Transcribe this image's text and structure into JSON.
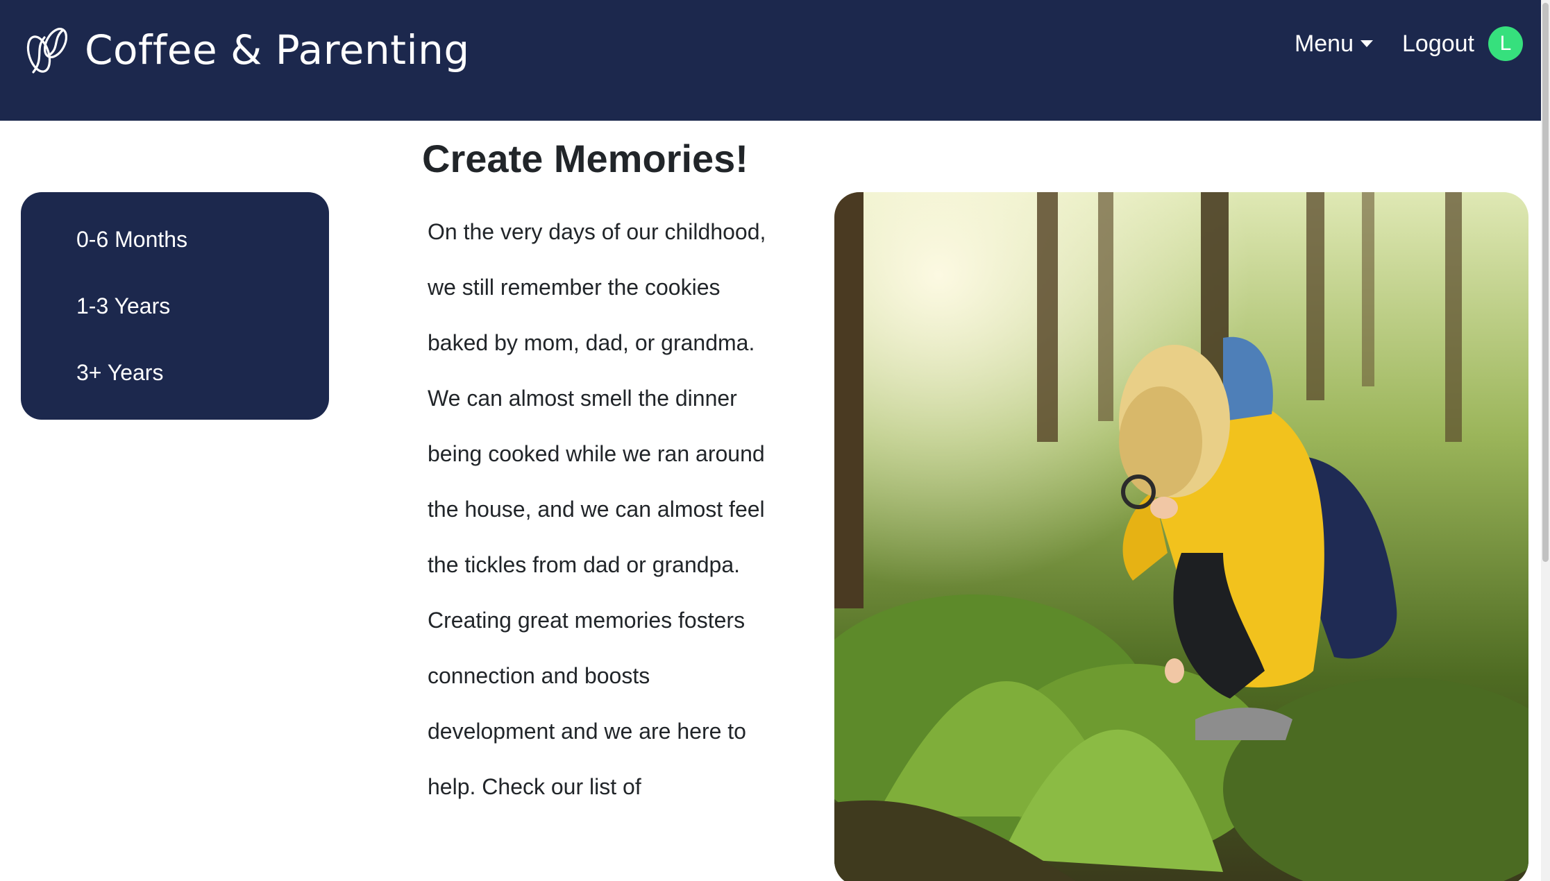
{
  "navbar": {
    "brand_title": "Coffee & Parenting",
    "logo_icon": "coffee-bean-icon",
    "menu_label": "Menu",
    "logout_label": "Logout",
    "avatar_initial": "L",
    "colors": {
      "background": "#1c284d",
      "avatar": "#36e07d"
    }
  },
  "sidebar": {
    "items": [
      {
        "label": "0-6 Months"
      },
      {
        "label": "1-3 Years"
      },
      {
        "label": "3+ Years"
      }
    ]
  },
  "main": {
    "title": "Create Memories!",
    "paragraphs": [
      "On the very days of our childhood, we still remember the cookies baked by mom, dad, or grandma. We can almost smell the dinner being cooked while we ran around the house, and we can almost feel the tickles from dad or grandpa.",
      "Creating great memories fosters connection and boosts development and we are here to help. Check our list of"
    ],
    "image": "child with magnifying glass in forest photo"
  }
}
